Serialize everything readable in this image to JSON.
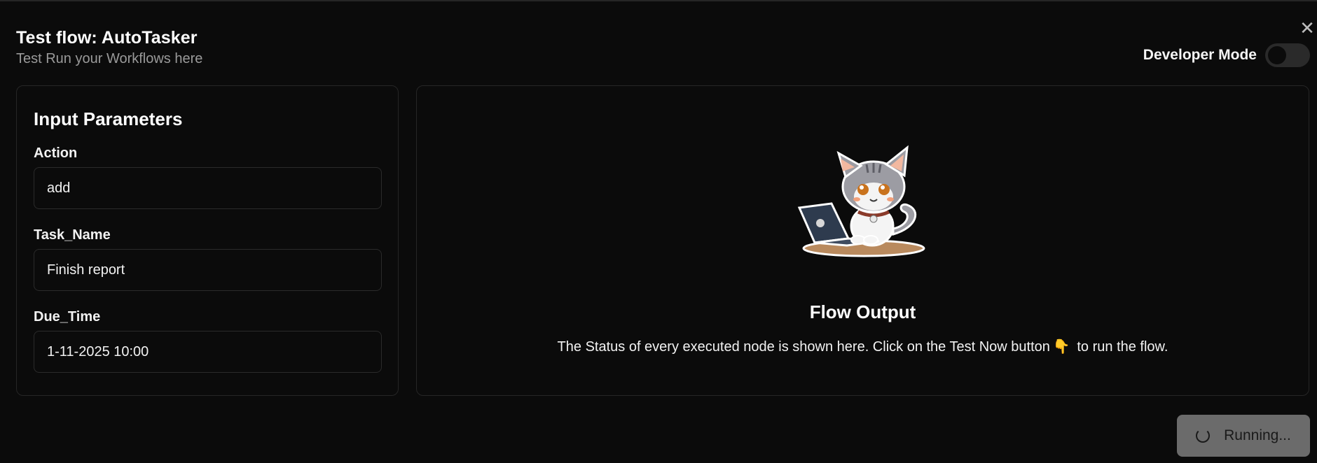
{
  "header": {
    "title": "Test flow: AutoTasker",
    "subtitle": "Test Run your Workflows here",
    "close_icon": "close-icon"
  },
  "developer_mode": {
    "label": "Developer Mode",
    "enabled": false
  },
  "input_panel": {
    "title": "Input Parameters",
    "fields": [
      {
        "label": "Action",
        "value": "add"
      },
      {
        "label": "Task_Name",
        "value": "Finish report"
      },
      {
        "label": "Due_Time",
        "value": "1-11-2025 10:00"
      }
    ]
  },
  "output_panel": {
    "title": "Flow Output",
    "description_before": "The Status of every executed node is shown here. Click on the Test Now button",
    "description_after": " to run the flow.",
    "icon": "pointing-hand-icon",
    "illustration": "cat-with-laptop-illustration"
  },
  "run_button": {
    "label": "Running...",
    "icon": "spinner-icon"
  },
  "colors": {
    "background": "#0b0b0b",
    "border": "#262626",
    "button_disabled": "#6b6b6b"
  }
}
